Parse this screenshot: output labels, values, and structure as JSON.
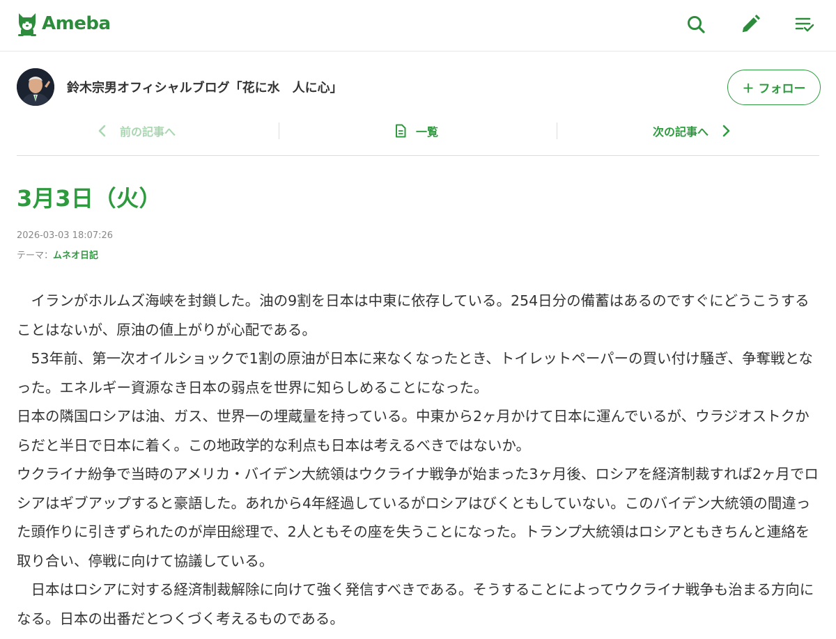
{
  "header": {
    "logo_text": "Ameba",
    "icons": [
      "search-icon",
      "pencil-icon",
      "checklist-icon"
    ]
  },
  "blog": {
    "title": "鈴木宗男オフィシャルブログ「花に水　人に心」",
    "follow_label": "＋ フォロー"
  },
  "pager": {
    "prev_label": "前の記事へ",
    "list_label": "一覧",
    "next_label": "次の記事へ"
  },
  "article": {
    "title": "3月3日（火）",
    "datetime": "2026-03-03 18:07:26",
    "theme_prefix": "テーマ：",
    "theme": "ムネオ日記",
    "paragraphs": [
      "イランがホルムズ海峡を封鎖した。油の9割を日本は中東に依存している。254日分の備蓄はあるのですぐにどうこうすることはないが、原油の値上がりが心配である。",
      "53年前、第一次オイルショックで1割の原油が日本に来なくなったとき、トイレットペーパーの買い付け騒ぎ、争奪戦となった。エネルギー資源なき日本の弱点を世界に知らしめることになった。",
      "日本の隣国ロシアは油、ガス、世界一の埋蔵量を持っている。中東から2ヶ月かけて日本に運んでいるが、ウラジオストクからだと半日で日本に着く。この地政学的な利点も日本は考えるべきではないか。",
      "ウクライナ紛争で当時のアメリカ・バイデン大統領はウクライナ戦争が始まった3ヶ月後、ロシアを経済制裁すれば2ヶ月でロシアはギブアップすると豪語した。あれから4年経過しているがロシアはびくともしていない。このバイデン大統領の間違った頭作りに引きずられたのが岸田総理で、2人ともその座を失うことになった。トランプ大統領はロシアともきちんと連絡を取り合い、停戦に向けて協議している。",
      "日本はロシアに対する経済制裁解除に向けて強く発信すべきである。そうすることによってウクライナ戦争も治まる方向になる。日本の出番だとつくづく考えるものである。"
    ]
  },
  "colors": {
    "brand": "#2d8c3c",
    "accent": "#2d9a3e",
    "accent_disabled": "#a9d6b0",
    "meta_text": "#888888",
    "body_text": "#333333"
  }
}
